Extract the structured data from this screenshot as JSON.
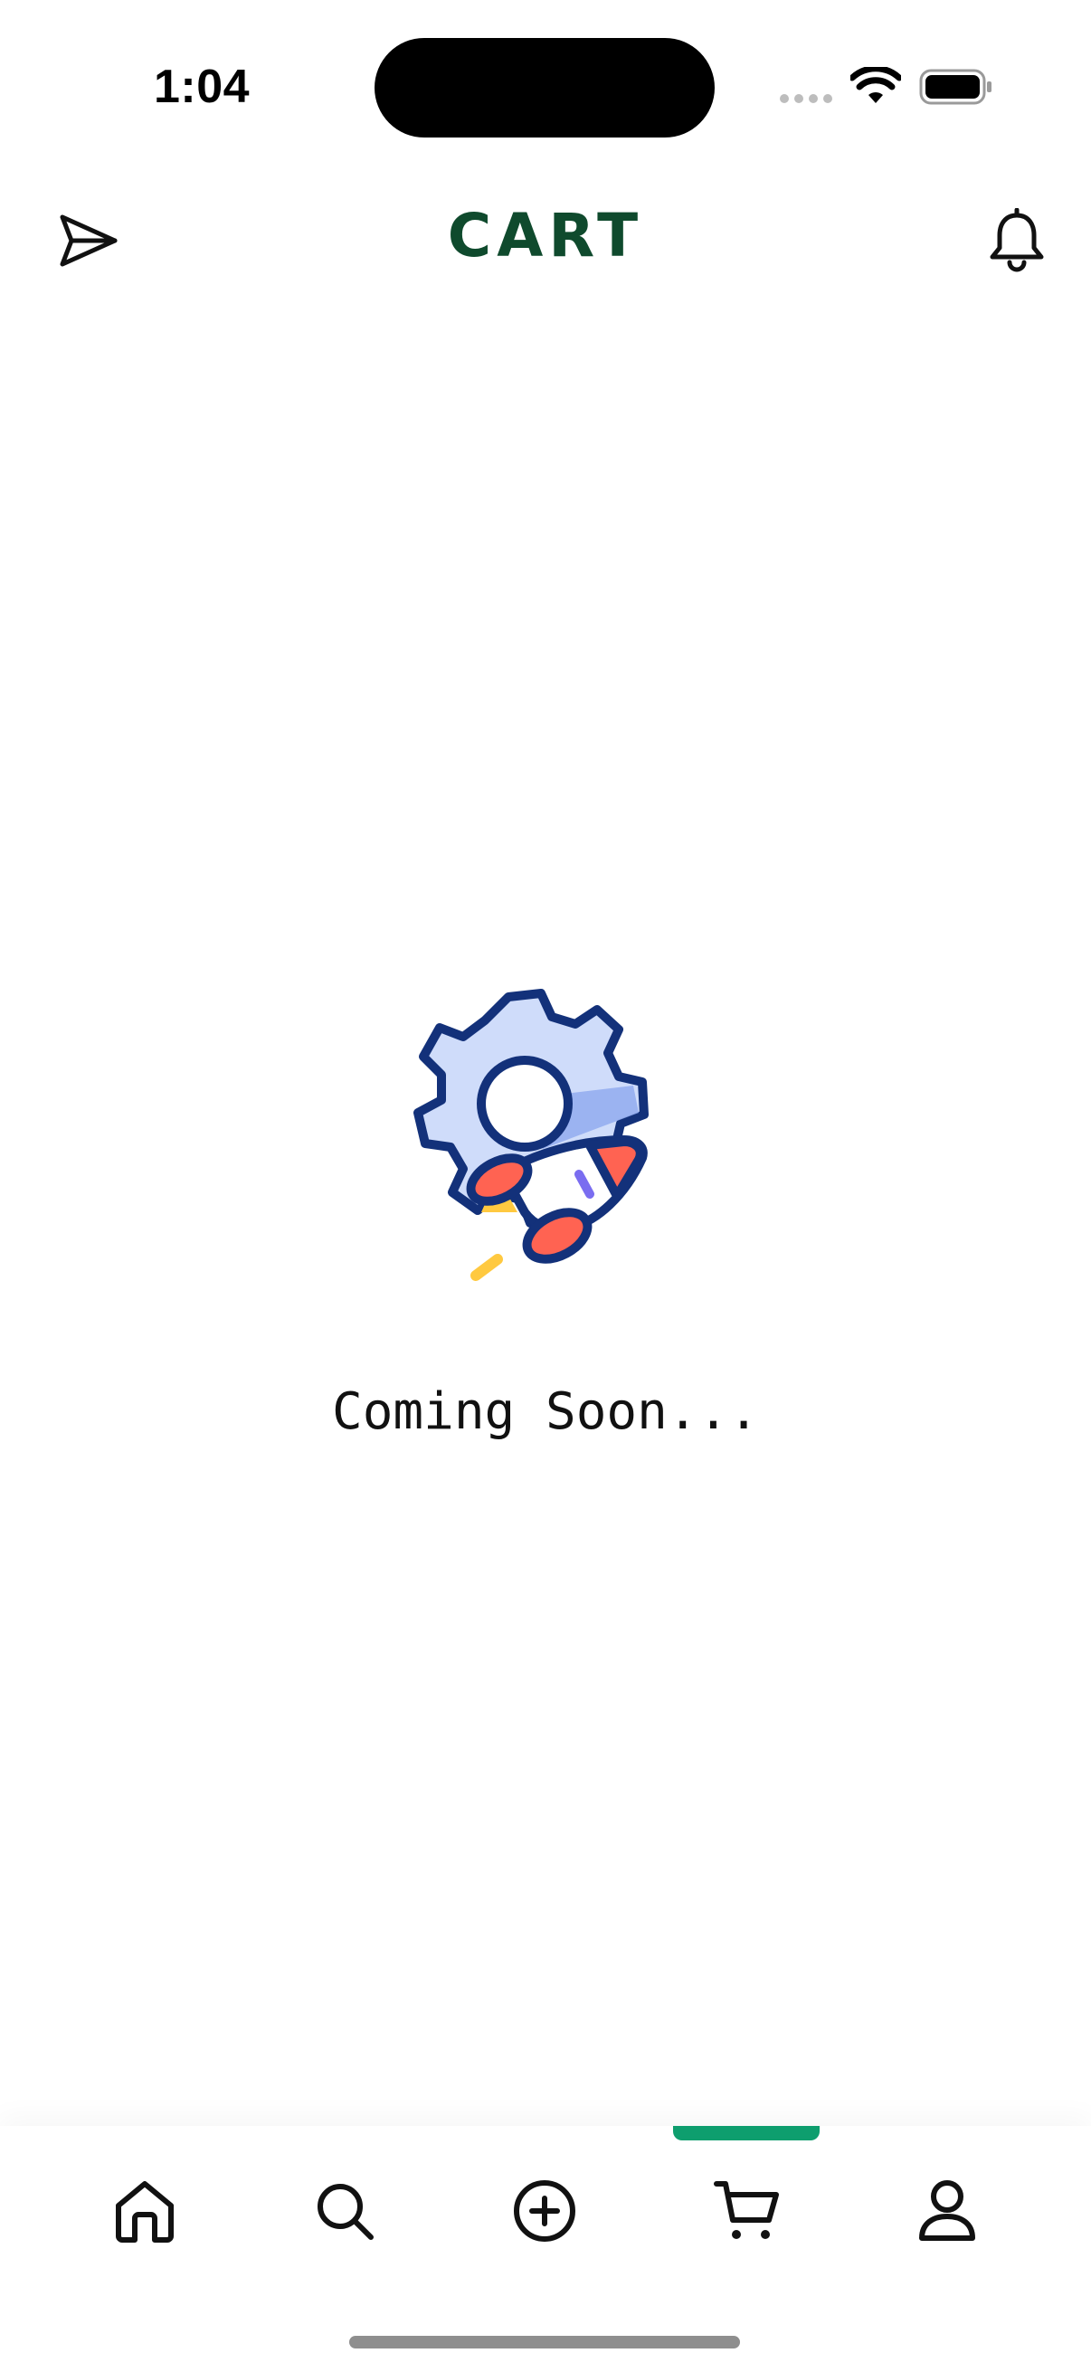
{
  "status_bar": {
    "time": "1:04"
  },
  "header": {
    "title": "CART",
    "left_icon": "send-icon",
    "right_icon": "bell-icon"
  },
  "content": {
    "message": "Coming Soon...",
    "illustration": "gear-rocket-illustration"
  },
  "bottom_nav": {
    "items": [
      {
        "icon": "home-icon",
        "active": false
      },
      {
        "icon": "search-icon",
        "active": false
      },
      {
        "icon": "plus-circle-icon",
        "active": false
      },
      {
        "icon": "cart-icon",
        "active": true
      },
      {
        "icon": "profile-icon",
        "active": false
      }
    ],
    "active_color": "#0e9e6e"
  },
  "colors": {
    "title": "#0f4a2d",
    "accent": "#0e9e6e"
  }
}
